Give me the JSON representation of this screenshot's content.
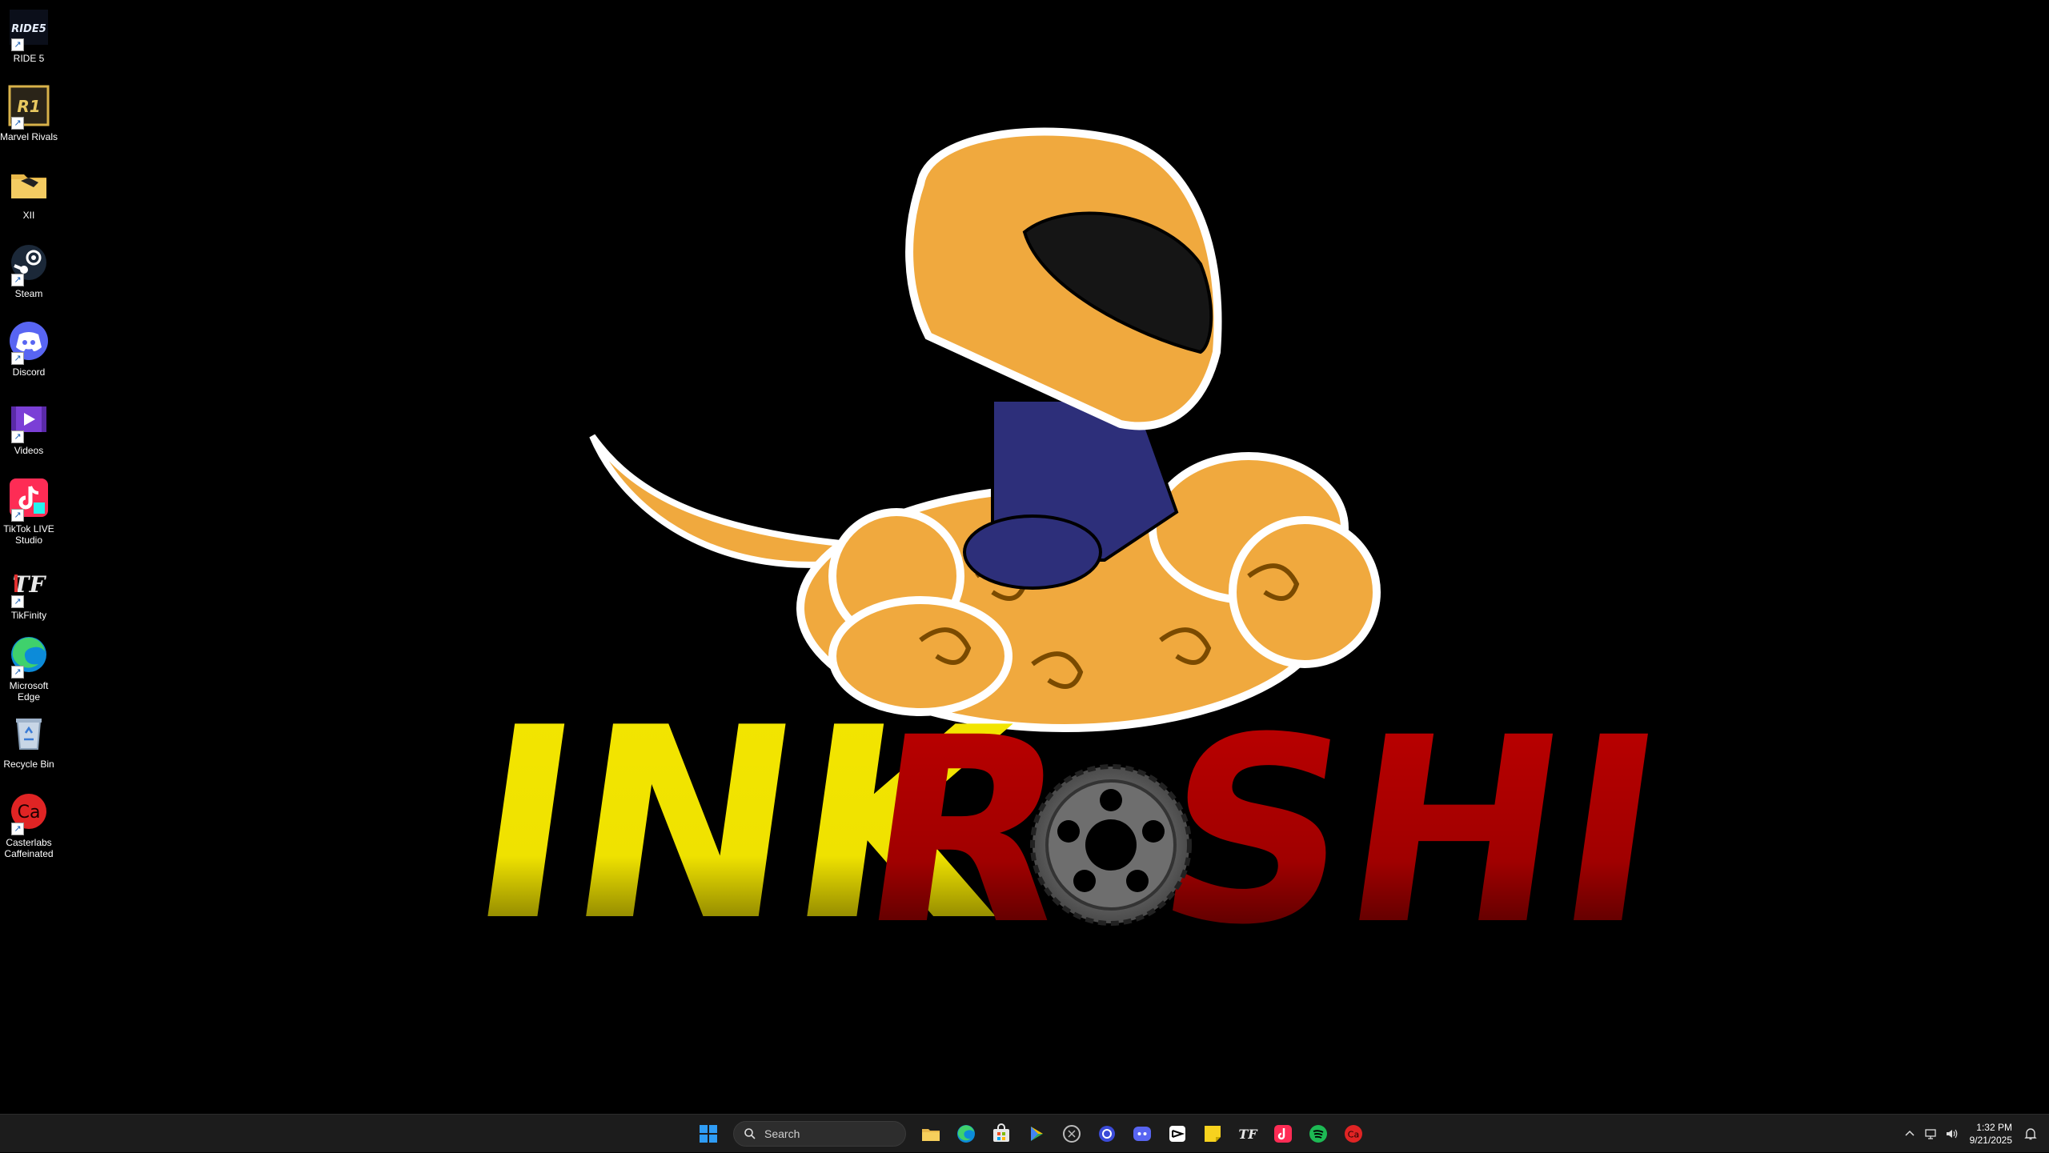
{
  "desktop": {
    "icons": [
      {
        "label": "RIDE 5",
        "icon": "ride5-icon",
        "badge": "RIDE5"
      },
      {
        "label": "Marvel Rivals",
        "icon": "marvel-rivals-icon",
        "badge": "R1"
      },
      {
        "label": "XII",
        "icon": "folder-icon"
      },
      {
        "label": "Steam",
        "icon": "steam-icon"
      },
      {
        "label": "Discord",
        "icon": "discord-icon"
      },
      {
        "label": "Videos",
        "icon": "videos-icon"
      },
      {
        "label": "TikTok LIVE Studio",
        "icon": "tiktok-live-studio-icon"
      },
      {
        "label": "TikFinity",
        "icon": "tikfinity-icon",
        "badge": "TF"
      },
      {
        "label": "Microsoft Edge",
        "icon": "edge-icon"
      },
      {
        "label": "Recycle Bin",
        "icon": "recycle-bin-icon"
      },
      {
        "label": "Casterlabs Caffeinated",
        "icon": "casterlabs-icon",
        "badge": "Ca"
      }
    ],
    "shortcut_arrow": "↗"
  },
  "wallpaper": {
    "logo_left": "INK",
    "logo_right_r": "R",
    "logo_right_rest": "SHI"
  },
  "taskbar": {
    "search_placeholder": "Search",
    "apps": [
      "start-icon",
      "file-explorer-icon",
      "edge-icon",
      "store-icon",
      "play-store-icon",
      "clipchamp-icon",
      "copilot-icon",
      "discord-icon",
      "capcut-icon",
      "sticky-notes-icon",
      "tikfinity-icon",
      "tiktok-icon",
      "spotify-icon",
      "casterlabs-icon"
    ],
    "tikfinity_badge": "TF",
    "casterlabs_badge": "Ca",
    "tray_icons": [
      "chevron-up-icon",
      "network-icon",
      "volume-icon"
    ],
    "time": "1:32 PM",
    "date": "9/21/2025"
  },
  "colors": {
    "accent_yellow": "#f2e400",
    "accent_red": "#b00000",
    "helmet_orange": "#f0a93e",
    "taskbar_bg": "#1c1c1c"
  }
}
